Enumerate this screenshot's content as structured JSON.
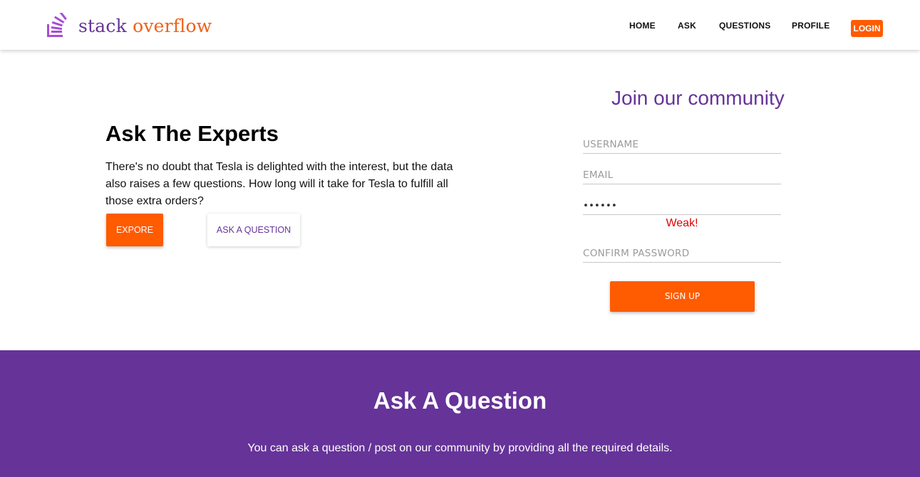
{
  "brand": {
    "word1": "stack",
    "word2": "overflow",
    "icon": "stack-overflow-logo-icon",
    "color_primary": "#663399",
    "color_accent": "#ff5b00"
  },
  "nav": {
    "items": [
      "HOME",
      "ASK",
      "QUESTIONS",
      "PROFILE"
    ],
    "login_label": "LOGIN"
  },
  "hero": {
    "title": "Ask The Experts",
    "text": "There's no doubt that Tesla is delighted with the interest, but the data also raises a few questions. How long will it take for Tesla to fulfill all those extra orders?",
    "explore_label": "EXPORE",
    "ask_label": "ASK A QUESTION"
  },
  "signup": {
    "title": "Join our community",
    "username_placeholder": "USERNAME",
    "email_placeholder": "EMAIL",
    "password_value": "••••••",
    "password_strength": "Weak!",
    "confirm_placeholder": "CONFIRM PASSWORD",
    "submit_label": "SIGN UP"
  },
  "ask_section": {
    "title": "Ask A Question",
    "description": "You can ask a question / post on our community by providing all the required details."
  }
}
